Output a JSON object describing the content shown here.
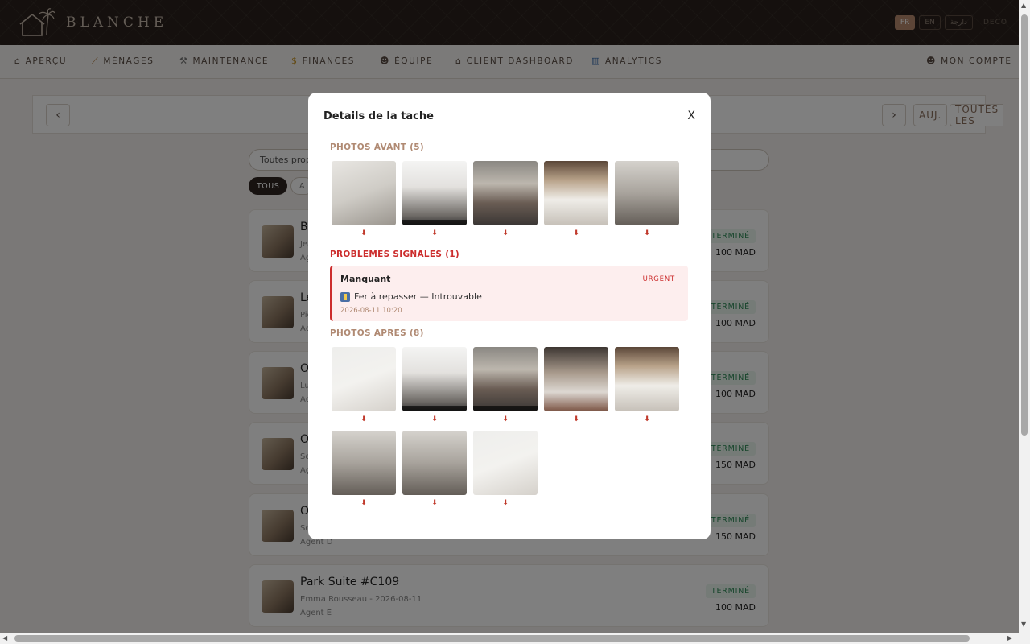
{
  "brand": {
    "name": "BLANCHE"
  },
  "languages": [
    {
      "label": "FR",
      "active": true
    },
    {
      "label": "EN",
      "active": false
    },
    {
      "label": "دارجة",
      "active": false
    }
  ],
  "deco_label": "DECO",
  "nav": {
    "items": [
      {
        "icon": "home-icon",
        "label": "APERÇU"
      },
      {
        "icon": "broom-icon",
        "label": "MÉNAGES"
      },
      {
        "icon": "wrench-icon",
        "label": "MAINTENANCE"
      },
      {
        "icon": "money-bag-icon",
        "label": "FINANCES"
      },
      {
        "icon": "team-icon",
        "label": "ÉQUIPE"
      },
      {
        "icon": "home-icon",
        "label": "CLIENT DASHBOARD"
      },
      {
        "icon": "bar-chart-icon",
        "label": "ANALYTICS"
      }
    ],
    "account": {
      "icon": "user-icon",
      "label": "MON COMPTE"
    }
  },
  "day_bar": {
    "prev": "‹",
    "next": "›",
    "today": "AUJ.",
    "all": "TOUTES LES"
  },
  "filters": {
    "property_select": "Toutes propri",
    "chips": [
      {
        "label": "TOUS",
        "active": true
      },
      {
        "label": "A",
        "active": false
      }
    ]
  },
  "tasks": [
    {
      "title": "Bo",
      "sub": "Jea",
      "agent": "Ag",
      "status": "TERMINÉ",
      "price": "100 MAD"
    },
    {
      "title": "Le",
      "sub": "Pie",
      "agent": "Ag",
      "status": "TERMINÉ",
      "price": "100 MAD"
    },
    {
      "title": "Oc",
      "sub": "Lu",
      "agent": "Ag",
      "status": "TERMINÉ",
      "price": "100 MAD"
    },
    {
      "title": "Oc",
      "sub": "So",
      "agent": "Ag",
      "status": "TERMINÉ",
      "price": "150 MAD"
    },
    {
      "title": "Oc",
      "sub": "So",
      "agent": "Agent D",
      "status": "TERMINÉ",
      "price": "150 MAD"
    },
    {
      "title": "Park Suite #C109",
      "sub": "Emma Rousseau - 2026-08-11",
      "agent": "Agent E",
      "status": "TERMINÉ",
      "price": "100 MAD"
    }
  ],
  "modal": {
    "title": "Details de la tache",
    "close": "X",
    "photos_before": {
      "title": "PHOTOS AVANT (5)",
      "download_glyph": "⬇"
    },
    "problems": {
      "title": "PROBLEMES SIGNALES (1)",
      "items": [
        {
          "type": "Manquant",
          "level": "URGENT",
          "description": "Fer à repasser — Introuvable",
          "date": "2026-08-11 10:20"
        }
      ]
    },
    "photos_after": {
      "title": "PHOTOS APRES (8)",
      "download_glyph": "⬇"
    }
  },
  "colors": {
    "header_bg": "#2b211c",
    "accent": "#b98a6f",
    "success": "#2e8b57",
    "danger": "#cc2d2d"
  }
}
